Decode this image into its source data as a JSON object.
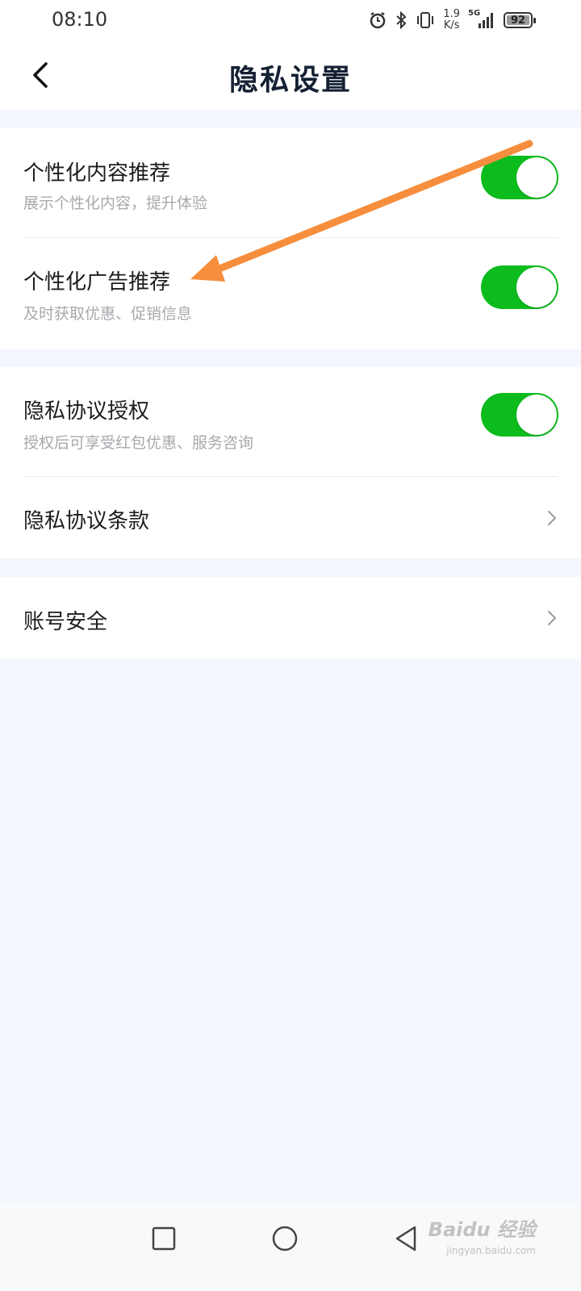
{
  "status_bar": {
    "time": "08:10",
    "network_speed": "1.9",
    "network_unit": "K/s",
    "network_type": "5G",
    "battery": "92",
    "icons": [
      "alarm-icon",
      "bluetooth-icon",
      "vibrate-icon",
      "signal-icon",
      "battery-icon"
    ]
  },
  "header": {
    "title": "隐私设置",
    "back_icon": "back-chevron-icon"
  },
  "sections": [
    {
      "items": [
        {
          "title": "个性化内容推荐",
          "subtitle": "展示个性化内容，提升体验",
          "control": "toggle",
          "on": true
        },
        {
          "title": "个性化广告推荐",
          "subtitle": "及时获取优惠、促销信息",
          "control": "toggle",
          "on": true
        }
      ]
    },
    {
      "items": [
        {
          "title": "隐私协议授权",
          "subtitle": "授权后可享受红包优惠、服务咨询",
          "control": "toggle",
          "on": true
        },
        {
          "title": "隐私协议条款",
          "control": "chevron"
        }
      ]
    },
    {
      "items": [
        {
          "title": "账号安全",
          "control": "chevron"
        }
      ]
    }
  ],
  "android_nav": {
    "icons": [
      "recent-apps-icon",
      "home-icon",
      "back-triangle-icon"
    ]
  },
  "watermark": {
    "main": "Baidu 经验",
    "sub": "jingyan.baidu.com"
  },
  "colors": {
    "toggle_on": "#0cbb1c",
    "page_background": "#f3f6fd",
    "arrow_annotation": "#f78e3d"
  }
}
